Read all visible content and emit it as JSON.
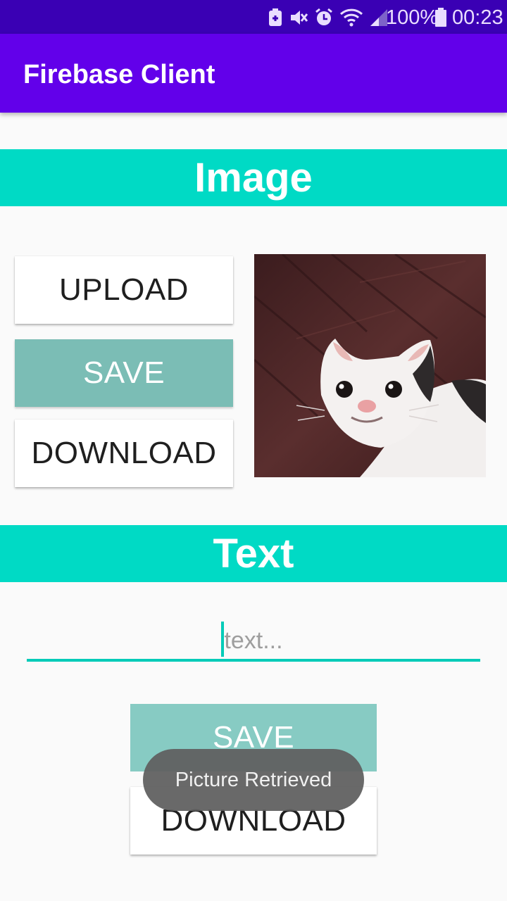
{
  "status_bar": {
    "battery": "100%",
    "time": "00:23",
    "icons": [
      "battery-saver-icon",
      "mute-icon",
      "alarm-icon",
      "wifi-icon",
      "signal-icon",
      "battery-icon"
    ]
  },
  "app_bar": {
    "title": "Firebase Client"
  },
  "image_section": {
    "header": "Image",
    "upload_label": "UPLOAD",
    "save_label": "SAVE",
    "download_label": "DOWNLOAD",
    "picture": "cat-photo"
  },
  "text_section": {
    "header": "Text",
    "input_value": "",
    "input_placeholder": "text...",
    "save_label": "SAVE",
    "download_label": "DOWNLOAD"
  },
  "toast": {
    "message": "Picture Retrieved"
  },
  "colors": {
    "status_bar": "#3a00b4",
    "app_bar": "#6200ea",
    "section_header": "#00dac5",
    "save_button": "#7bbdb5",
    "accent": "#00cbb8"
  }
}
